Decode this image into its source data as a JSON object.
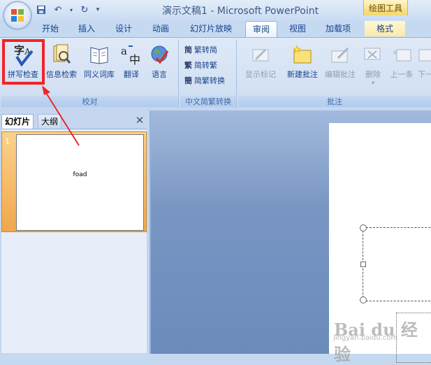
{
  "window": {
    "title": "演示文稿1 - Microsoft PowerPoint",
    "context_tab": "绘图工具"
  },
  "tabs": [
    "开始",
    "插入",
    "设计",
    "动画",
    "幻灯片放映",
    "审阅",
    "视图",
    "加载项",
    "格式"
  ],
  "active_tab": "审阅",
  "ribbon": {
    "proofing": {
      "label": "校对",
      "spell_check": "拼写检查",
      "research": "信息检索",
      "thesaurus": "同义词库",
      "translate": "翻译",
      "language": "语言"
    },
    "chinese_conv": {
      "label": "中文简繁转换",
      "to_simplified": "繁转简",
      "to_traditional": "简转繁",
      "conversion": "简繁转换"
    },
    "comments": {
      "label": "批注",
      "show_markup": "显示标记",
      "new_comment": "新建批注",
      "edit_comment": "编辑批注",
      "delete": "删除",
      "previous": "上一条",
      "next": "下一"
    }
  },
  "left_panel": {
    "tab_slides": "幻灯片",
    "tab_outline": "大纲",
    "slides": [
      {
        "number": "1",
        "text": "foad"
      }
    ]
  },
  "watermark": {
    "text": "Bai du 经验",
    "sub": "jingyan.baidu.com"
  }
}
